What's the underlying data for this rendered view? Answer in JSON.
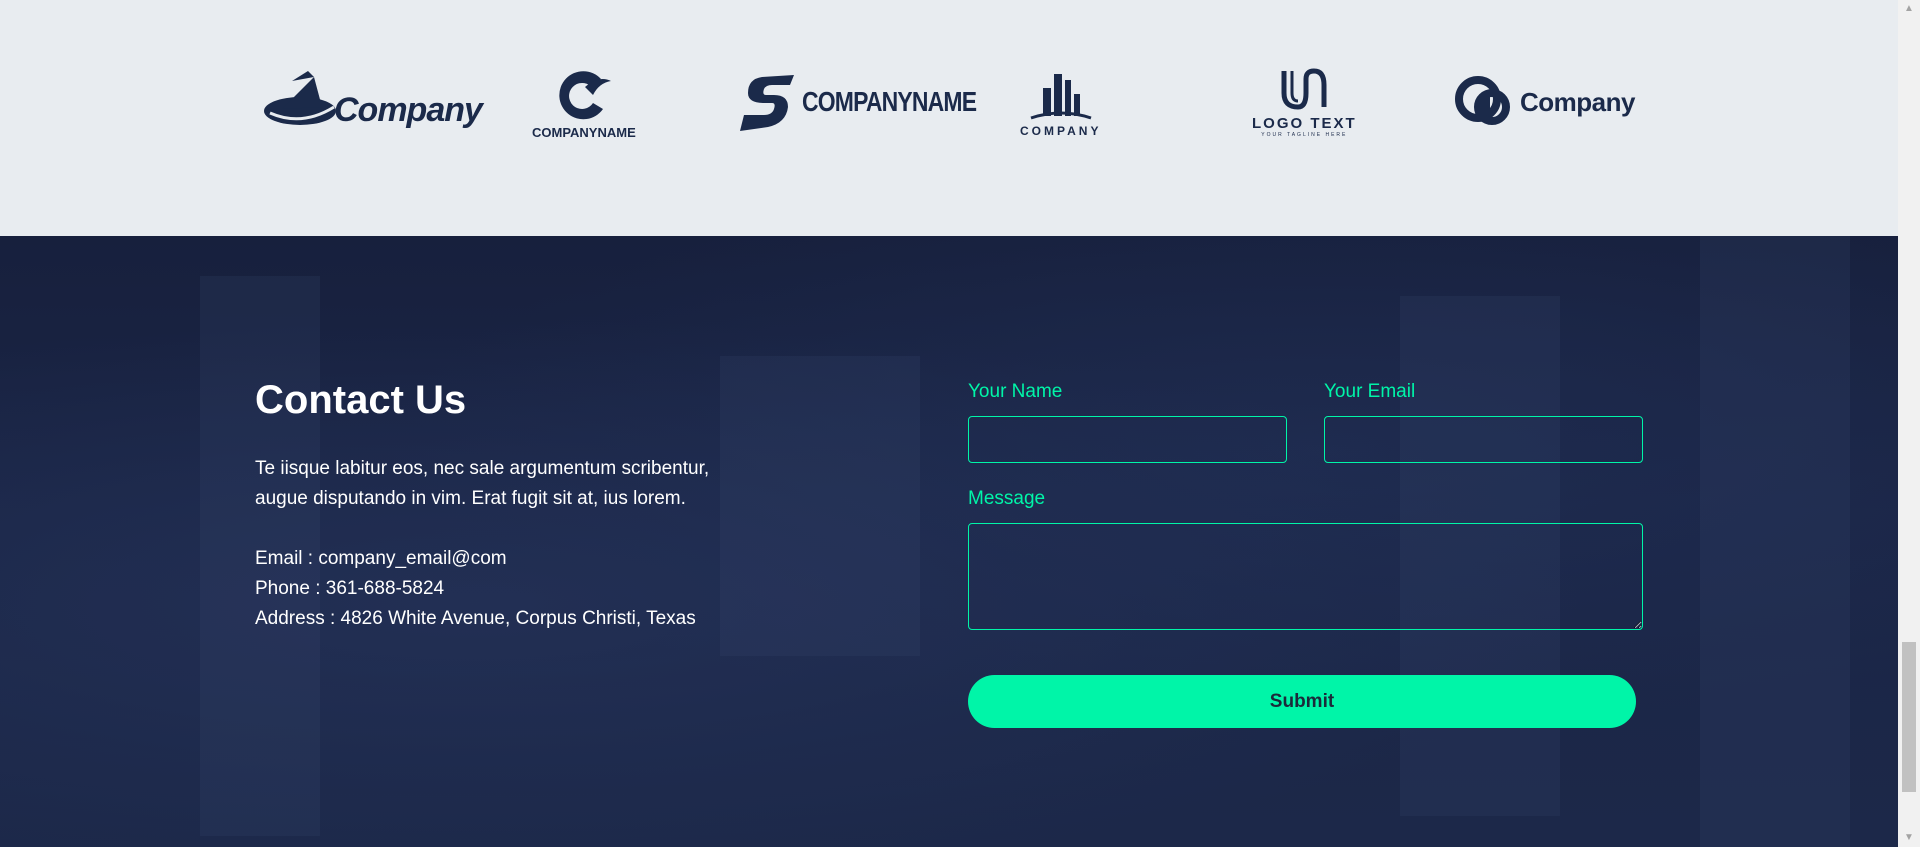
{
  "logos": [
    {
      "name": "Company",
      "style": "hat"
    },
    {
      "name": "COMPANYNAME",
      "style": "c-mark"
    },
    {
      "name": "COMPANYNAME",
      "style": "s-mark"
    },
    {
      "name": "COMPANY",
      "style": "buildings"
    },
    {
      "name": "LOGO TEXT",
      "tagline": "YOUR TAGLINE HERE",
      "style": "u-mark"
    },
    {
      "name": "Company",
      "style": "link-mark"
    }
  ],
  "contact": {
    "heading": "Contact Us",
    "description": "Te iisque labitur eos, nec sale argumentum scribentur, augue disputando in vim. Erat fugit sit at, ius lorem.",
    "email": "Email : company_email@com",
    "phone": "Phone : 361-688-5824",
    "address": "Address : 4826 White Avenue, Corpus Christi, Texas"
  },
  "form": {
    "name_label": "Your Name",
    "name_value": "",
    "email_label": "Your Email",
    "email_value": "",
    "message_label": "Message",
    "message_value": "",
    "submit_label": "Submit"
  },
  "colors": {
    "accent": "#00f5a8",
    "navy": "#1b2a4a",
    "band": "#e8ecf0"
  }
}
